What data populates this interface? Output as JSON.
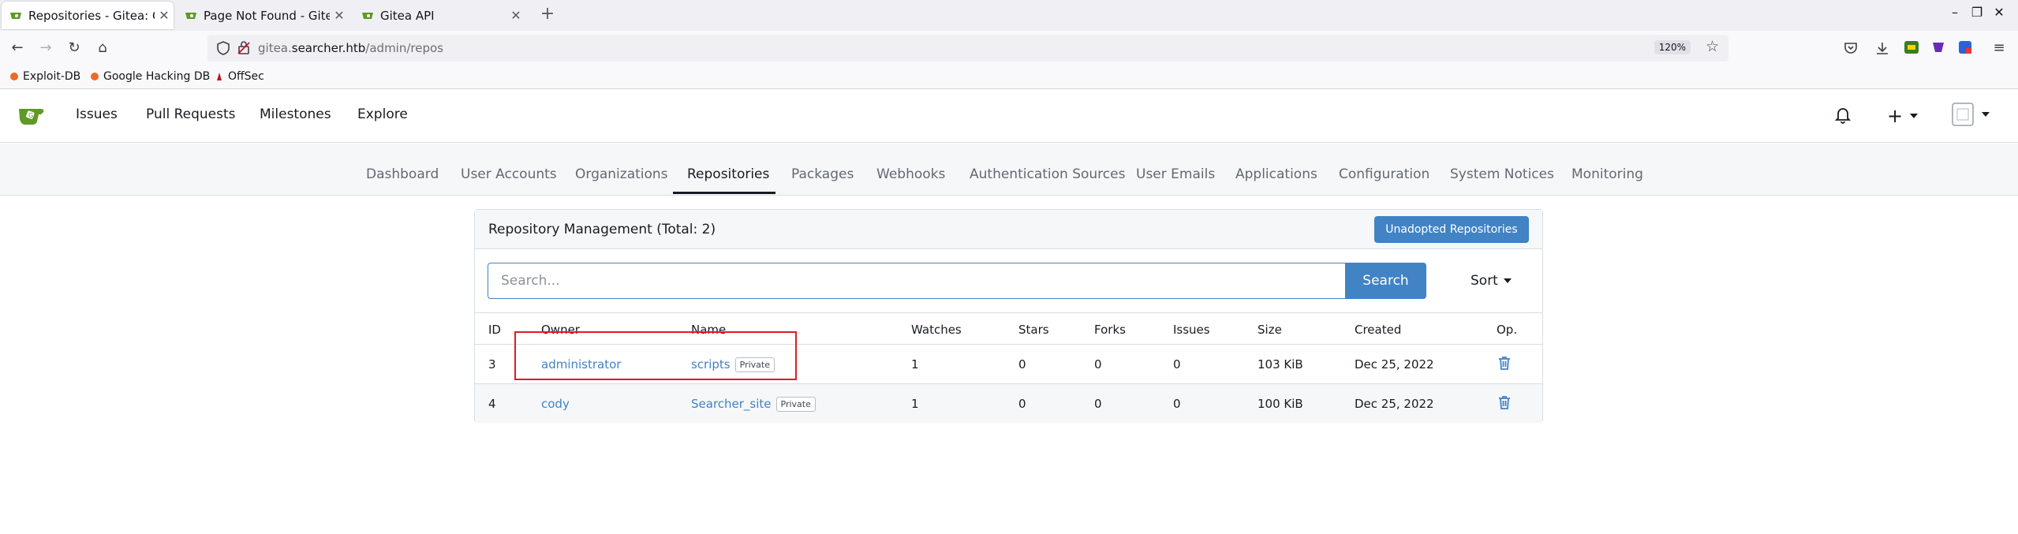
{
  "browser": {
    "tabs": [
      {
        "title": "Repositories - Gitea: Git w",
        "active": true
      },
      {
        "title": "Page Not Found - Gitea: G",
        "active": false
      },
      {
        "title": "Gitea API",
        "active": false
      }
    ],
    "url_prefix": "gitea.",
    "url_host": "searcher.htb",
    "url_path": "/admin/repos",
    "zoom": "120%",
    "bookmarks": [
      "Exploit-DB",
      "Google Hacking DB",
      "OffSec"
    ]
  },
  "header": {
    "nav": [
      "Issues",
      "Pull Requests",
      "Milestones",
      "Explore"
    ]
  },
  "admin_tabs": [
    "Dashboard",
    "User Accounts",
    "Organizations",
    "Repositories",
    "Packages",
    "Webhooks",
    "Authentication Sources",
    "User Emails",
    "Applications",
    "Configuration",
    "System Notices",
    "Monitoring"
  ],
  "active_admin_tab": "Repositories",
  "panel": {
    "title": "Repository Management (Total: 2)",
    "unadopted_label": "Unadopted Repositories",
    "search_placeholder": "Search...",
    "search_label": "Search",
    "sort_label": "Sort"
  },
  "table": {
    "columns": [
      "ID",
      "Owner",
      "Name",
      "Watches",
      "Stars",
      "Forks",
      "Issues",
      "Size",
      "Created",
      "Op."
    ],
    "rows": [
      {
        "id": "3",
        "owner": "administrator",
        "name": "scripts",
        "badge": "Private",
        "watches": "1",
        "stars": "0",
        "forks": "0",
        "issues": "0",
        "size": "103 KiB",
        "created": "Dec 25, 2022"
      },
      {
        "id": "4",
        "owner": "cody",
        "name": "Searcher_site",
        "badge": "Private",
        "watches": "1",
        "stars": "0",
        "forks": "0",
        "issues": "0",
        "size": "100 KiB",
        "created": "Dec 25, 2022"
      }
    ]
  },
  "colors": {
    "accent": "#4183c4",
    "gitea_green": "#609926",
    "highlight": "#e01b24"
  }
}
